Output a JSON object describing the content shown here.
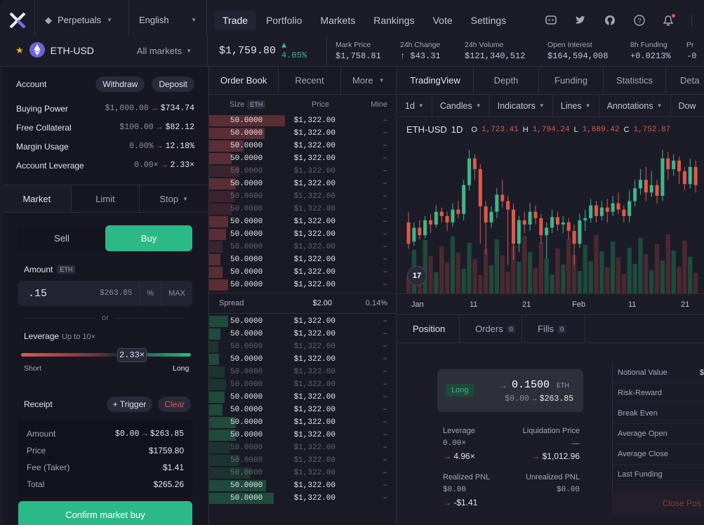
{
  "nav": {
    "network": "Perpetuals",
    "language": "English",
    "tabs": [
      "Trade",
      "Portfolio",
      "Markets",
      "Rankings",
      "Vote",
      "Settings"
    ]
  },
  "market": {
    "symbol": "ETH-USD",
    "all_markets": "All markets",
    "price": "$1,759.80",
    "change_pct": "4.05%",
    "stats": [
      {
        "label": "Mark Price",
        "value": "$1,758.81"
      },
      {
        "label": "24h Change",
        "value": "$43.31"
      },
      {
        "label": "24h Volume",
        "value": "$121,340,512"
      },
      {
        "label": "Open Interest",
        "value": "$164,594,008"
      },
      {
        "label": "8h Funding",
        "value": "+0.0213%"
      },
      {
        "label": "Pr",
        "value": "-0"
      }
    ]
  },
  "account": {
    "title": "Account",
    "withdraw": "Withdraw",
    "deposit": "Deposit",
    "rows": [
      {
        "label": "Buying Power",
        "from": "$1,000.00",
        "to": "$734.74"
      },
      {
        "label": "Free Collateral",
        "from": "$100.00",
        "to": "$82.12"
      },
      {
        "label": "Margin Usage",
        "from": "0.00%",
        "to": "12.18%"
      },
      {
        "label": "Account Leverage",
        "from": "0.00×",
        "to": "2.33×"
      }
    ]
  },
  "order": {
    "tabs": [
      "Market",
      "Limit",
      "Stop"
    ],
    "sell": "Sell",
    "buy": "Buy",
    "amount_label": "Amount",
    "amount_unit": "ETH",
    "amount_value": ".15",
    "amount_usd": "$263.85",
    "percent": "%",
    "max": "MAX",
    "or": "or",
    "leverage_label": "Leverage",
    "leverage_hint": "Up to 10×",
    "leverage_value": "2.33×",
    "leverage_fraction": 0.233,
    "short": "Short",
    "long": "Long",
    "receipt_title": "Receipt",
    "trigger": "+ Trigger",
    "clear": "Clear",
    "receipt": [
      {
        "k": "Amount",
        "v": "$263.85",
        "from": "$0.00"
      },
      {
        "k": "Price",
        "v": "$1759.80"
      },
      {
        "k": "Fee (Taker)",
        "v": "$1.41"
      },
      {
        "k": "Total",
        "v": "$265.26"
      }
    ],
    "confirm": "Confirm market buy"
  },
  "orderbook": {
    "tabs": [
      "Order Book",
      "Recent",
      "More"
    ],
    "col_size": "Size",
    "col_size_unit": "ETH",
    "col_price": "Price",
    "col_mine": "Mine",
    "spread_label": "Spread",
    "spread_value": "$2.00",
    "spread_pct": "0.14%",
    "asks": [
      {
        "size": "50.0000",
        "price": "$1,322.00",
        "mine": "–",
        "depth": 1.0,
        "dim": false
      },
      {
        "size": "50.0000",
        "price": "$1,322.00",
        "mine": "–",
        "depth": 0.73,
        "dim": false
      },
      {
        "size": "50.0000",
        "price": "$1,322.00",
        "mine": "–",
        "depth": 0.45,
        "dim": false
      },
      {
        "size": "50.0000",
        "price": "$1,322.00",
        "mine": "–",
        "depth": 0.3,
        "dim": false
      },
      {
        "size": "50.0000",
        "price": "$1,322.00",
        "mine": "–",
        "depth": 0.4,
        "dim": true
      },
      {
        "size": "50.0000",
        "price": "$1,322.00",
        "mine": "–",
        "depth": 0.35,
        "dim": false
      },
      {
        "size": "50.0000",
        "price": "$1,322.00",
        "mine": "–",
        "depth": 0.33,
        "dim": true
      },
      {
        "size": "50.0000",
        "price": "$1,322.00",
        "mine": "–",
        "depth": 0.3,
        "dim": true
      },
      {
        "size": "50.0000",
        "price": "$1,322.00",
        "mine": "–",
        "depth": 0.25,
        "dim": false
      },
      {
        "size": "50.0000",
        "price": "$1,322.00",
        "mine": "–",
        "depth": 0.22,
        "dim": false
      },
      {
        "size": "50.0000",
        "price": "$1,322.00",
        "mine": "–",
        "depth": 0.18,
        "dim": true
      },
      {
        "size": "50.0000",
        "price": "$1,322.00",
        "mine": "–",
        "depth": 0.15,
        "dim": false
      },
      {
        "size": "50.0000",
        "price": "$1,322.00",
        "mine": "–",
        "depth": 0.18,
        "dim": false
      },
      {
        "size": "50.0000",
        "price": "$1,322.00",
        "mine": "–",
        "depth": 0.25,
        "dim": false
      }
    ],
    "bids": [
      {
        "size": "50.0000",
        "price": "$1,322.00",
        "mine": "–",
        "depth": 0.25,
        "dim": false
      },
      {
        "size": "50.0000",
        "price": "$1,322.00",
        "mine": "–",
        "depth": 0.15,
        "dim": false
      },
      {
        "size": "50.0000",
        "price": "$1,322.00",
        "mine": "–",
        "depth": 0.12,
        "dim": true
      },
      {
        "size": "50.0000",
        "price": "$1,322.00",
        "mine": "–",
        "depth": 0.13,
        "dim": false
      },
      {
        "size": "50.0000",
        "price": "$1,322.00",
        "mine": "–",
        "depth": 0.2,
        "dim": true
      },
      {
        "size": "50.0000",
        "price": "$1,322.00",
        "mine": "–",
        "depth": 0.22,
        "dim": true
      },
      {
        "size": "50.0000",
        "price": "$1,322.00",
        "mine": "–",
        "depth": 0.2,
        "dim": false
      },
      {
        "size": "50.0000",
        "price": "$1,322.00",
        "mine": "–",
        "depth": 0.18,
        "dim": false
      },
      {
        "size": "50.0000",
        "price": "$1,322.00",
        "mine": "–",
        "depth": 0.35,
        "dim": false
      },
      {
        "size": "50.0000",
        "price": "$1,322.00",
        "mine": "–",
        "depth": 0.35,
        "dim": false
      },
      {
        "size": "50.0000",
        "price": "$1,322.00",
        "mine": "–",
        "depth": 0.28,
        "dim": true
      },
      {
        "size": "50.0000",
        "price": "$1,322.00",
        "mine": "–",
        "depth": 0.4,
        "dim": true
      },
      {
        "size": "50.0000",
        "price": "$1,322.00",
        "mine": "–",
        "depth": 0.55,
        "dim": true
      },
      {
        "size": "50.0000",
        "price": "$1,322.00",
        "mine": "–",
        "depth": 0.75,
        "dim": false
      },
      {
        "size": "50.0000",
        "price": "$1,322.00",
        "mine": "–",
        "depth": 0.85,
        "dim": false
      }
    ]
  },
  "chart": {
    "tabs": [
      "TradingView",
      "Depth",
      "Funding",
      "Statistics",
      "Deta"
    ],
    "tools": [
      "1d",
      "Candles",
      "Indicators",
      "Lines",
      "Annotations",
      "Dow"
    ],
    "symbol": "ETH-USD",
    "interval": "1D",
    "ohlc": [
      {
        "k": "O",
        "v": "1,723.41"
      },
      {
        "k": "H",
        "v": "1,794.24"
      },
      {
        "k": "L",
        "v": "1,689.42"
      },
      {
        "k": "C",
        "v": "1,752.87"
      }
    ],
    "xticks": [
      "Jan",
      "11",
      "21",
      "Feb",
      "11",
      "21"
    ],
    "tv_logo": "17"
  },
  "chart_data": {
    "type": "candlestick",
    "candles": [
      [
        60,
        40,
        70,
        35
      ],
      [
        42,
        55,
        60,
        38
      ],
      [
        55,
        48,
        62,
        44
      ],
      [
        48,
        62,
        66,
        45
      ],
      [
        62,
        58,
        68,
        50
      ],
      [
        58,
        70,
        76,
        55
      ],
      [
        70,
        66,
        74,
        60
      ],
      [
        66,
        60,
        70,
        52
      ],
      [
        60,
        72,
        78,
        56
      ],
      [
        72,
        68,
        80,
        64
      ],
      [
        68,
        95,
        100,
        62
      ],
      [
        95,
        120,
        128,
        90
      ],
      [
        120,
        110,
        124,
        100
      ],
      [
        110,
        75,
        115,
        40
      ],
      [
        75,
        60,
        80,
        30
      ],
      [
        60,
        70,
        75,
        55
      ],
      [
        70,
        86,
        92,
        64
      ],
      [
        86,
        80,
        100,
        74
      ],
      [
        80,
        72,
        85,
        20
      ],
      [
        72,
        40,
        78,
        25
      ],
      [
        40,
        62,
        66,
        32
      ],
      [
        62,
        58,
        70,
        50
      ],
      [
        58,
        70,
        78,
        52
      ],
      [
        70,
        64,
        76,
        58
      ],
      [
        64,
        48,
        68,
        40
      ],
      [
        48,
        55,
        60,
        26
      ],
      [
        55,
        65,
        72,
        50
      ],
      [
        65,
        58,
        70,
        52
      ],
      [
        58,
        60,
        66,
        50
      ],
      [
        60,
        52,
        64,
        44
      ],
      [
        52,
        40,
        58,
        20
      ],
      [
        40,
        62,
        68,
        36
      ],
      [
        62,
        64,
        72,
        52
      ],
      [
        64,
        76,
        82,
        60
      ],
      [
        76,
        66,
        80,
        60
      ],
      [
        66,
        74,
        80,
        62
      ],
      [
        74,
        70,
        82,
        60
      ],
      [
        70,
        78,
        85,
        66
      ],
      [
        78,
        72,
        88,
        68
      ],
      [
        72,
        66,
        76,
        60
      ],
      [
        66,
        80,
        90,
        60
      ],
      [
        80,
        92,
        100,
        75
      ],
      [
        92,
        100,
        110,
        86
      ],
      [
        100,
        88,
        112,
        80
      ],
      [
        88,
        95,
        108,
        84
      ],
      [
        95,
        85,
        100,
        78
      ],
      [
        85,
        120,
        128,
        80
      ],
      [
        120,
        110,
        126,
        100
      ],
      [
        110,
        118,
        124,
        104
      ],
      [
        118,
        108,
        122,
        96
      ],
      [
        108,
        96,
        112,
        90
      ],
      [
        96,
        112,
        120,
        92
      ],
      [
        112,
        95,
        118,
        88
      ]
    ]
  },
  "position": {
    "tabs": [
      {
        "label": "Position",
        "count": ""
      },
      {
        "label": "Orders",
        "count": "0"
      },
      {
        "label": "Fills",
        "count": "0"
      }
    ],
    "side": "Long",
    "size": "0.1500",
    "unit": "ETH",
    "notional_from": "$0.00",
    "notional_to": "$263.85",
    "leverage_label": "Leverage",
    "leverage_from": "0.00×",
    "leverage_to": "4.96×",
    "liq_label": "Liquidation Price",
    "liq_from": "—",
    "liq_to": "$1,012.96",
    "rpnl_label": "Realized PNL",
    "rpnl_from": "$0.00",
    "rpnl_to": "-$1.41",
    "upnl_label": "Unrealized PNL",
    "upnl_value": "$0.00",
    "metrics": [
      "Notional Value",
      "Risk-Reward",
      "Break Even",
      "Average Open",
      "Average Close",
      "Last Funding"
    ],
    "metric_value_first": "$",
    "close": "Close Pos"
  },
  "colors": {
    "accent": "#2bb987",
    "red": "#e0584a",
    "green": "#3fb68b"
  }
}
